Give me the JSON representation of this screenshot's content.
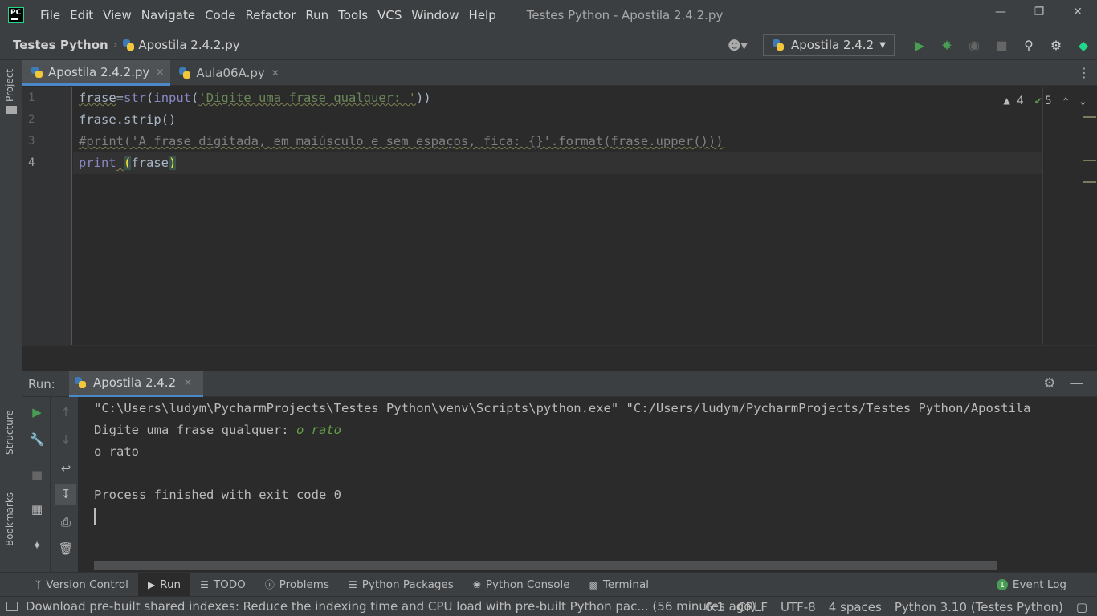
{
  "menubar": {
    "logo_text": "PC",
    "items": [
      "File",
      "Edit",
      "View",
      "Navigate",
      "Code",
      "Refactor",
      "Run",
      "Tools",
      "VCS",
      "Window",
      "Help"
    ],
    "window_title": "Testes Python - Apostila 2.4.2.py"
  },
  "navbar": {
    "project": "Testes Python",
    "file": "Apostila 2.4.2.py",
    "run_config": "Apostila 2.4.2"
  },
  "left_strip": {
    "project_label": "Project",
    "structure_label": "Structure",
    "bookmarks_label": "Bookmarks"
  },
  "editor": {
    "tabs": [
      {
        "label": "Apostila 2.4.2.py",
        "active": true
      },
      {
        "label": "Aula06A.py",
        "active": false
      }
    ],
    "line_numbers": [
      "1",
      "2",
      "3",
      "4"
    ],
    "lines": {
      "l1_a": "frase",
      "l1_b": "=",
      "l1_c": "str",
      "l1_d": "(",
      "l1_e": "input",
      "l1_f": "(",
      "l1_g": "'Digite uma frase qualquer: '",
      "l1_h": "))",
      "l2": "frase.strip()",
      "l3": "#print('A frase digitada, em maiúsculo e sem espaços, fica: {}'.format(frase.upper()))",
      "l4_kw": "print",
      "l4_sp": " ",
      "l4_open": "(",
      "l4_arg": "frase",
      "l4_close": ")"
    },
    "warnings_count": "4",
    "ok_count": "5"
  },
  "run_panel": {
    "title": "Run:",
    "tab_label": "Apostila 2.4.2",
    "console": {
      "command": "\"C:\\Users\\ludym\\PycharmProjects\\Testes Python\\venv\\Scripts\\python.exe\" \"C:/Users/ludym/PycharmProjects/Testes Python/Apostila",
      "prompt": "Digite uma frase qualquer: ",
      "user_input": "o rato",
      "output": "o rato",
      "exit_message": "Process finished with exit code 0"
    }
  },
  "bottom_tools": {
    "items": [
      {
        "label": "Version Control",
        "icon": "branch-icon"
      },
      {
        "label": "Run",
        "icon": "run-icon",
        "active": true
      },
      {
        "label": "TODO",
        "icon": "list-icon"
      },
      {
        "label": "Problems",
        "icon": "problems-icon"
      },
      {
        "label": "Python Packages",
        "icon": "packages-icon"
      },
      {
        "label": "Python Console",
        "icon": "python-icon"
      },
      {
        "label": "Terminal",
        "icon": "terminal-icon"
      }
    ],
    "event_log_count": "1",
    "event_log_label": "Event Log"
  },
  "statusbar": {
    "message": "Download pre-built shared indexes: Reduce the indexing time and CPU load with pre-built Python pac... (56 minutes ago)",
    "position": "6:1",
    "line_sep": "CRLF",
    "encoding": "UTF-8",
    "indent": "4 spaces",
    "interpreter": "Python 3.10 (Testes Python)"
  },
  "colors": {
    "background": "#2b2b2b",
    "panel": "#3c3f41",
    "accent": "#4a88c7",
    "run_green": "#499c54"
  }
}
